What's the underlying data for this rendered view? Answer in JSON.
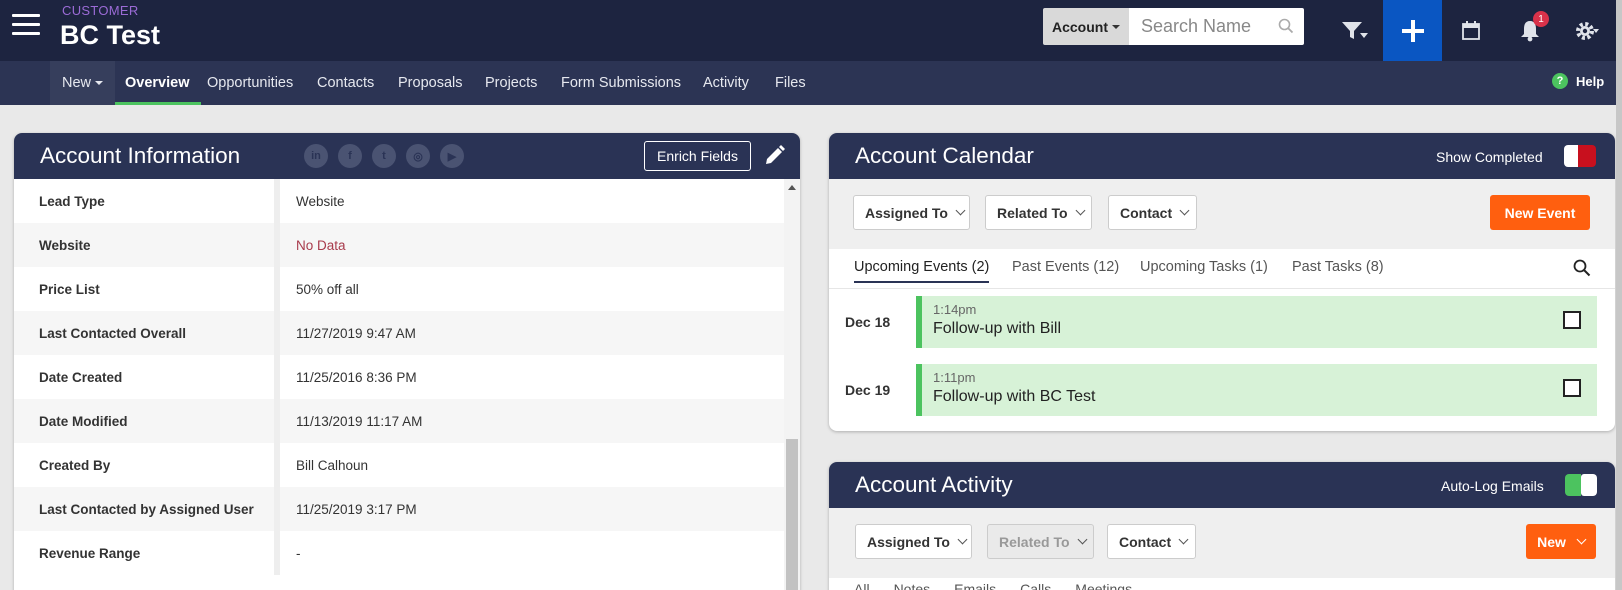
{
  "header": {
    "record_type": "CUSTOMER",
    "record_name": "BC Test",
    "search": {
      "scope_label": "Account",
      "placeholder": "Search Name"
    },
    "notification_count": "1"
  },
  "subnav": {
    "new_label": "New",
    "tabs": [
      {
        "label": "Overview",
        "active": true
      },
      {
        "label": "Opportunities"
      },
      {
        "label": "Contacts"
      },
      {
        "label": "Proposals"
      },
      {
        "label": "Projects"
      },
      {
        "label": "Form Submissions"
      },
      {
        "label": "Activity"
      },
      {
        "label": "Files"
      }
    ],
    "help_label": "Help"
  },
  "account_info": {
    "title": "Account Information",
    "social_icons": [
      "linkedin-icon",
      "facebook-icon",
      "twitter-icon",
      "instagram-icon",
      "youtube-icon"
    ],
    "enrich_label": "Enrich Fields",
    "rows": [
      {
        "label": "Lead Type",
        "value": "Website"
      },
      {
        "label": "Website",
        "value": "No Data"
      },
      {
        "label": "Price List",
        "value": "50% off all"
      },
      {
        "label": "Last Contacted Overall",
        "value": "11/27/2019 9:47 AM"
      },
      {
        "label": "Date Created",
        "value": "11/25/2016 8:36 PM"
      },
      {
        "label": "Date Modified",
        "value": "11/13/2019 11:17 AM"
      },
      {
        "label": "Created By",
        "value": "Bill Calhoun"
      },
      {
        "label": "Last Contacted by Assigned User",
        "value": "11/25/2019 3:17 PM"
      },
      {
        "label": "Revenue Range",
        "value": "-"
      }
    ]
  },
  "calendar": {
    "title": "Account Calendar",
    "show_completed_label": "Show Completed",
    "filters": {
      "assigned": "Assigned To",
      "related": "Related To",
      "contact": "Contact"
    },
    "new_event_label": "New Event",
    "tabs": [
      {
        "label": "Upcoming Events (2)",
        "active": true
      },
      {
        "label": "Past Events (12)"
      },
      {
        "label": "Upcoming Tasks (1)"
      },
      {
        "label": "Past Tasks (8)"
      }
    ],
    "events": [
      {
        "date": "Dec 18",
        "time": "1:14pm",
        "title": "Follow-up with Bill"
      },
      {
        "date": "Dec 19",
        "time": "1:11pm",
        "title": "Follow-up with BC Test"
      }
    ]
  },
  "activity": {
    "title": "Account Activity",
    "auto_log_label": "Auto-Log Emails",
    "filters": {
      "assigned": "Assigned To",
      "related": "Related To",
      "contact": "Contact"
    },
    "new_label": "New",
    "tabs": [
      "All",
      "Notes",
      "Emails",
      "Calls",
      "Meetings"
    ]
  },
  "colors": {
    "header_bg": "#1d2440",
    "subnav_bg": "#2c3454",
    "card_header": "#2a3355",
    "accent_green": "#4cc35f",
    "accent_orange": "#ff5f0f",
    "plus_blue": "#0a56c2",
    "no_data_red": "#a83b4c"
  }
}
